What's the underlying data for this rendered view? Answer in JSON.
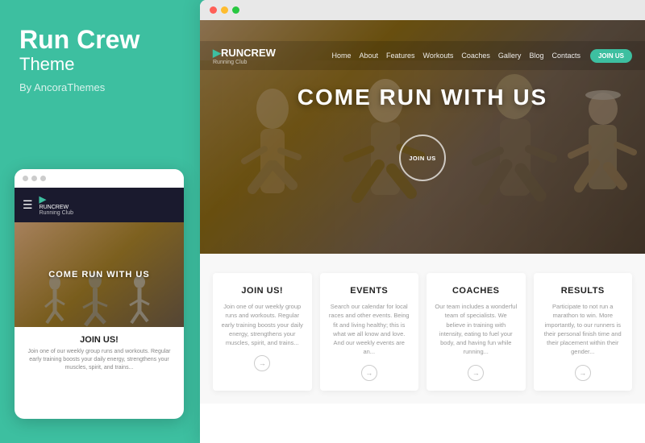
{
  "left": {
    "brand": "Run Crew",
    "sub": "Theme",
    "byline": "By AncoraThemes"
  },
  "mobile": {
    "logo": "RUNCREW",
    "logo_sub": "Running Club",
    "hero_text": "COME RUN WITH US",
    "join_title": "JOIN US!",
    "join_text": "Join one of our weekly group runs and workouts. Regular early training boosts your daily energy, strengthens your muscles, spirit, and trains..."
  },
  "browser": {
    "nav": {
      "logo": "RUNCREW",
      "logo_sub": "Running Club",
      "links": [
        "Home",
        "About",
        "Features",
        "Workouts",
        "Coaches",
        "Gallery",
        "Blog",
        "Contacts"
      ],
      "join_btn": "JOIN US"
    },
    "hero": {
      "title": "COME RUN WITH US",
      "join_btn": "JOIN US"
    },
    "cards": [
      {
        "title": "JOIN US!",
        "text": "Join one of our weekly group runs and workouts. Regular early training boosts your daily energy, strengthens your muscles, spirit, and trains..."
      },
      {
        "title": "EVENTS",
        "text": "Search our calendar for local races and other events. Being fit and living healthy; this is what we all know and love. And our weekly events are an..."
      },
      {
        "title": "COACHES",
        "text": "Our team includes a wonderful team of specialists. We believe in training with intensity, eating to fuel your body, and having fun while running..."
      },
      {
        "title": "RESULTS",
        "text": "Participate to not run a marathon to win. More importantly, to our runners is their personal finish time and their placement within their gender..."
      }
    ]
  },
  "colors": {
    "accent": "#3dbfa0",
    "dark": "#1a1a2e",
    "text_dark": "#222222",
    "text_muted": "#999999"
  }
}
